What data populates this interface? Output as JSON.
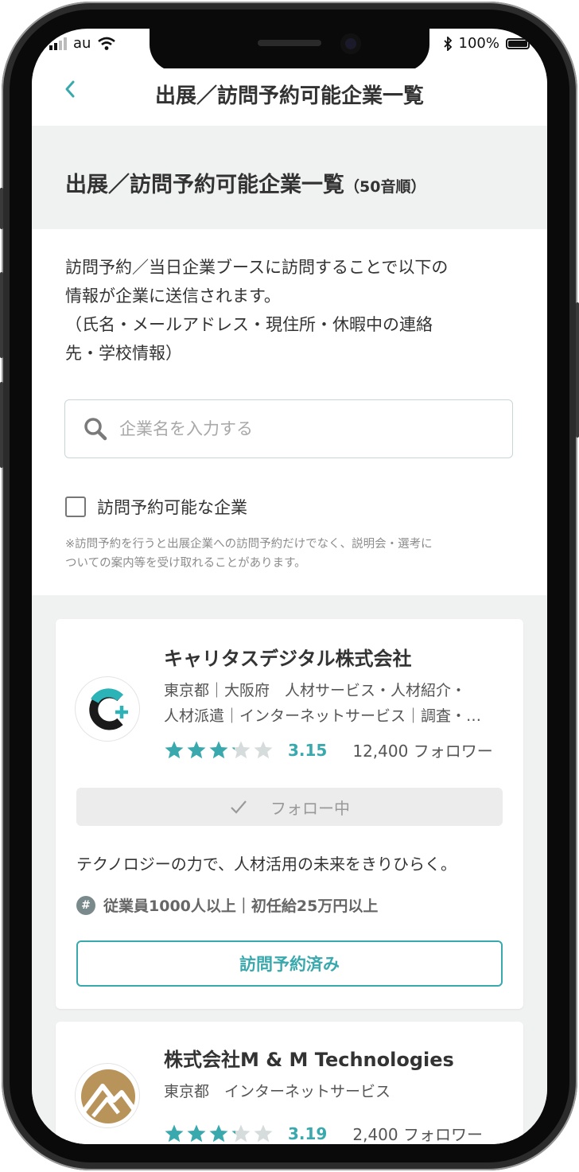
{
  "status_bar": {
    "carrier": "au",
    "battery": "100%"
  },
  "nav": {
    "back_icon": "chevron-left-icon",
    "title": "出展／訪問予約可能企業一覧"
  },
  "header": {
    "title": "出展／訪問予約可能企業一覧",
    "sort_note": "（50音順）"
  },
  "intro": {
    "line1": "訪問予約／当日企業ブースに訪問することで以下の",
    "line2": "情報が企業に送信されます。",
    "line3": "（氏名・メールアドレス・現住所・休暇中の連絡",
    "line4": "先・学校情報）"
  },
  "search": {
    "placeholder": "企業名を入力する",
    "value": ""
  },
  "filter": {
    "label": "訪問予約可能な企業",
    "checked": false
  },
  "note": {
    "line1": "※訪問予約を行うと出展企業への訪問予約だけでなく、説明会・選考に",
    "line2": "ついての案内等を受け取れることがあります。"
  },
  "companies": [
    {
      "name": "キャリタスデジタル株式会社",
      "tags_line1": "東京都｜大阪府　人材サービス・人材紹介・",
      "tags_line2": "人材派遣｜インターネットサービス｜調査・…",
      "rating": "3.15",
      "rating_fraction": 0.63,
      "followers": "12,400 フォロワー",
      "follow_label": "フォロー中",
      "tagline": "テクノロジーの力で、人材活用の未来をきりひらく。",
      "features": "従業員1000人以上｜初任給25万円以上",
      "visit_label": "訪問予約済み"
    },
    {
      "name": "株式会社M & M Technologies",
      "tags_line1": "東京都　インターネットサービス",
      "rating": "3.19",
      "rating_fraction": 0.638,
      "followers": "2,400 フォロワー"
    }
  ],
  "colors": {
    "accent": "#3aa9ad",
    "background_gray": "#f0f1f1",
    "text": "#333333",
    "muted": "#8c8c8c"
  }
}
